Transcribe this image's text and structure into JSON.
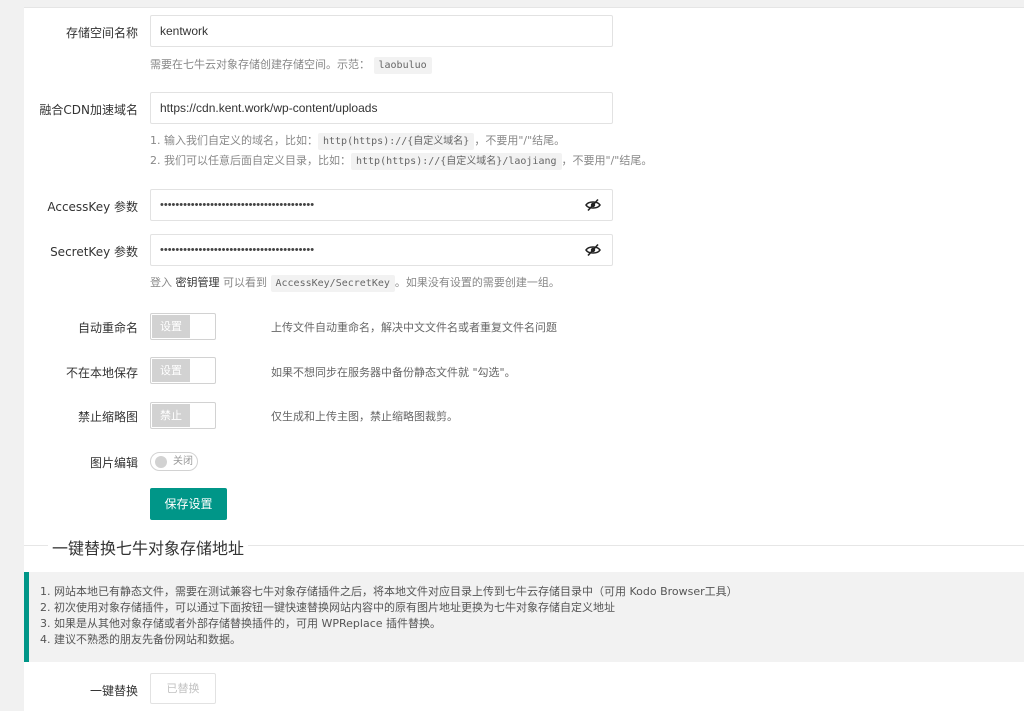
{
  "form": {
    "bucket": {
      "label": "存储空间名称",
      "value": "kentwork",
      "hint_prefix": "需要在七牛云对象存储创建存储空间。示范：",
      "hint_code": "laobuluo"
    },
    "cdn": {
      "label": "融合CDN加速域名",
      "value": "https://cdn.kent.work/wp-content/uploads",
      "hint1_prefix": "1. 输入我们自定义的域名，比如：",
      "hint1_code": "http(https)://{自定义域名}",
      "hint1_suffix": "，不要用\"/\"结尾。",
      "hint2_prefix": "2. 我们可以任意后面自定义目录，比如：",
      "hint2_code": "http(https)://{自定义域名}/laojiang",
      "hint2_suffix": "，不要用\"/\"结尾。"
    },
    "access_key": {
      "label": "AccessKey 参数",
      "value": "••••••••••••••••••••••••••••••••••••••••"
    },
    "secret_key": {
      "label": "SecretKey 参数",
      "value": "••••••••••••••••••••••••••••••••••••••••",
      "hint_prefix": "登入",
      "hint_link": "密钥管理",
      "hint_mid": "可以看到",
      "hint_code": "AccessKey/SecretKey",
      "hint_suffix": "。如果没有设置的需要创建一组。"
    },
    "auto_rename": {
      "label": "自动重命名",
      "switch_text": "设置",
      "desc": "上传文件自动重命名，解决中文文件名或者重复文件名问题"
    },
    "no_local": {
      "label": "不在本地保存",
      "switch_text": "设置",
      "desc": "如果不想同步在服务器中备份静态文件就 \"勾选\"。"
    },
    "no_thumb": {
      "label": "禁止缩略图",
      "switch_text": "禁止",
      "desc": "仅生成和上传主图，禁止缩略图裁剪。"
    },
    "image_edit": {
      "label": "图片编辑",
      "toggle_text": "关闭"
    },
    "save_label": "保存设置"
  },
  "replace_section": {
    "title": "一键替换七牛对象存储地址",
    "notes": [
      "1. 网站本地已有静态文件，需要在测试兼容七牛对象存储插件之后，将本地文件对应目录上传到七牛云存储目录中（可用 Kodo Browser工具）",
      "2. 初次使用对象存储插件，可以通过下面按钮一键快速替换网站内容中的原有图片地址更换为七牛对象存储自定义地址",
      "3. 如果是从其他对象存储或者外部存储替换插件的，可用 WPReplace 插件替换。",
      "4. 建议不熟悉的朋友先备份网站和数据。"
    ],
    "replace_label": "一键替换",
    "replace_button": "已替换"
  },
  "colors": {
    "primary": "#009688",
    "switch_off": "#d2d2d2"
  },
  "icons": {
    "eye": "eye-off-icon"
  }
}
